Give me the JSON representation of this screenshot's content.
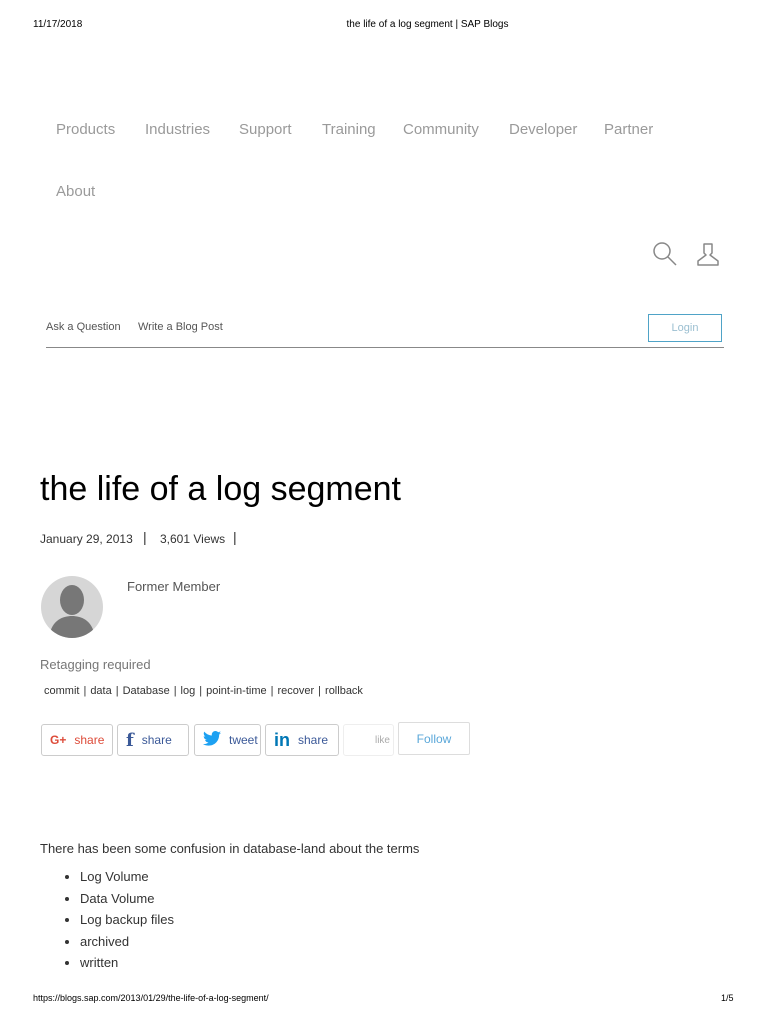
{
  "header": {
    "date": "11/17/2018",
    "title": "the life of a log segment | SAP Blogs"
  },
  "nav": {
    "items": [
      "Products",
      "Industries",
      "Support",
      "Training",
      "Community",
      "Developer",
      "Partner",
      "About"
    ]
  },
  "subnav": {
    "ask": "Ask a Question",
    "write": "Write a Blog Post",
    "login": "Login"
  },
  "article": {
    "title": "the life of a log segment",
    "date": "January 29, 2013",
    "views": "3,601 Views",
    "author": "Former Member",
    "retag": "Retagging required",
    "tags": [
      "commit",
      "data",
      "Database",
      "log",
      "point-in-time",
      "recover",
      "rollback"
    ],
    "share": {
      "gplus": "share",
      "facebook": "share",
      "twitter": "tweet",
      "linkedin": "share",
      "like": "like",
      "follow": "Follow"
    },
    "intro": "There has been some confusion in database-land about the terms",
    "terms": [
      "Log Volume",
      "Data Volume",
      "Log backup files",
      "archived",
      "written"
    ]
  },
  "footer": {
    "url": "https://blogs.sap.com/2013/01/29/the-life-of-a-log-segment/",
    "page": "1/5"
  },
  "colors": {
    "accent": "#4fa3c7",
    "gplus": "#dd4b39",
    "facebook": "#3b5998",
    "twitter": "#1da1f2",
    "linkedin": "#0077b5"
  }
}
